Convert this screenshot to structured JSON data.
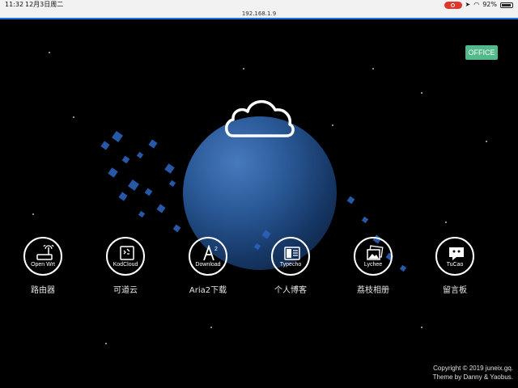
{
  "status_bar": {
    "time": "11:32",
    "date": "12月3日周二",
    "battery": "92%"
  },
  "url_bar": {
    "url": "192.168.1.9"
  },
  "office_button": "OFFICE",
  "apps": [
    {
      "icon_label": "Open Wrt",
      "caption": "路由器",
      "icon": "router-icon"
    },
    {
      "icon_label": "KodCloud",
      "caption": "可道云",
      "icon": "kodcloud-icon"
    },
    {
      "icon_label": "Download",
      "caption": "Aria2下载",
      "icon": "download-icon"
    },
    {
      "icon_label": "Typecho",
      "caption": "个人博客",
      "icon": "typecho-icon"
    },
    {
      "icon_label": "Lychee",
      "caption": "荔枝相册",
      "icon": "lychee-icon"
    },
    {
      "icon_label": "TuCao",
      "caption": "留言板",
      "icon": "tucao-icon"
    }
  ],
  "footer": {
    "line1": "Copyright © 2019 juneix.gq.",
    "line2": "Theme by Danny & Yaobus."
  }
}
